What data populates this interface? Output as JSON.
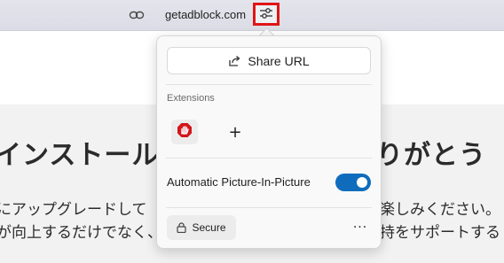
{
  "addressbar": {
    "url": "getadblock.com",
    "link_icon": "link-icon",
    "settings_icon": "sliders-icon"
  },
  "page": {
    "heading_left": "インストール",
    "heading_right": "りがとう",
    "line1_left": "にアップグレードして",
    "line1_right": "楽しみください。",
    "line2_left": "が向上するだけでなく、",
    "line2_right": "持をサポートする"
  },
  "popup": {
    "share_label": "Share URL",
    "share_icon": "share-icon",
    "extensions_label": "Extensions",
    "extensions": [
      {
        "name": "adblock-extension-icon"
      },
      {
        "name": "add-extension-icon",
        "glyph": "+"
      }
    ],
    "pip_label": "Automatic Picture-In-Picture",
    "pip_enabled": true,
    "secure_label": "Secure",
    "secure_icon": "lock-icon",
    "more_label": "···"
  },
  "colors": {
    "accent": "#0f6cbd",
    "highlight": "#e01515",
    "adblock_red": "#d2151b"
  }
}
